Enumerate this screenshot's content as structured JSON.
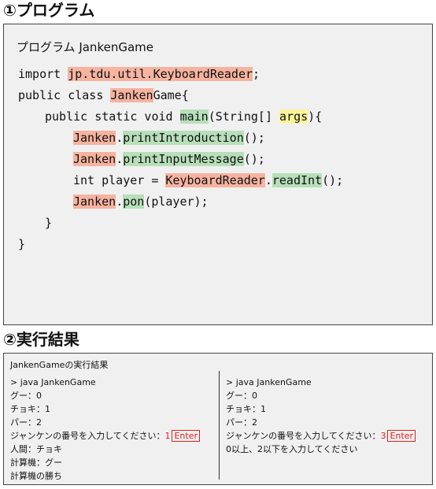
{
  "headings": {
    "program": "①プログラム",
    "result": "②実行結果"
  },
  "program": {
    "title": "プログラム JankenGame",
    "lines": [
      [
        {
          "t": "import "
        },
        {
          "t": "jp.tdu.util.KeyboardReader",
          "hl": "red"
        },
        {
          "t": ";"
        }
      ],
      [
        {
          "t": "public class "
        },
        {
          "t": "Janken",
          "hl": "red"
        },
        {
          "t": "Game{"
        }
      ],
      [
        {
          "t": "public static void "
        },
        {
          "t": "main",
          "hl": "green"
        },
        {
          "t": "(String[] "
        },
        {
          "t": "args",
          "hl": "yellow"
        },
        {
          "t": "){"
        }
      ],
      [
        {
          "t": "Janken",
          "hl": "red"
        },
        {
          "t": "."
        },
        {
          "t": "printIntroduction",
          "hl": "green"
        },
        {
          "t": "();"
        }
      ],
      [
        {
          "t": "Janken",
          "hl": "red"
        },
        {
          "t": "."
        },
        {
          "t": "printInputMessage",
          "hl": "green"
        },
        {
          "t": "();"
        }
      ],
      [
        {
          "t": "int player = "
        },
        {
          "t": "KeyboardReader",
          "hl": "red"
        },
        {
          "t": "."
        },
        {
          "t": "readInt",
          "hl": "green"
        },
        {
          "t": "();"
        }
      ],
      [
        {
          "t": "Janken",
          "hl": "red"
        },
        {
          "t": "."
        },
        {
          "t": "pon",
          "hl": "green"
        },
        {
          "t": "(player);"
        }
      ],
      [
        {
          "t": "}"
        }
      ],
      [
        {
          "t": "}"
        }
      ]
    ]
  },
  "result": {
    "title": "JankenGameの実行結果",
    "left": [
      "> java JankenGame",
      "グー：0",
      "チョキ：1",
      "パー：2",
      {
        "prompt": "ジャンケンの番号を入力してください：",
        "input": "1",
        "key": "Enter"
      },
      "人間：チョキ",
      "計算機：グー",
      "計算機の勝ち"
    ],
    "right": [
      "> java JankenGame",
      "グー：0",
      "チョキ：1",
      "パー：2",
      {
        "prompt": "ジャンケンの番号を入力してください：",
        "input": "3",
        "key": "Enter"
      },
      "0以上、2以下を入力してください"
    ]
  },
  "colors": {
    "highlight_red": "#f5b3a0",
    "highlight_green": "#b7dfb9",
    "highlight_yellow": "#fbf59a",
    "input_red": "#e02020"
  }
}
